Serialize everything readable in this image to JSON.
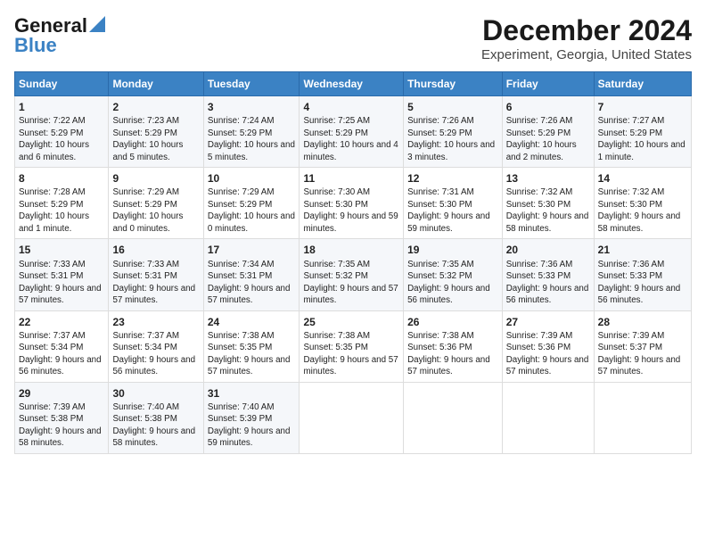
{
  "header": {
    "logo_line1": "General",
    "logo_line2": "Blue",
    "title": "December 2024",
    "subtitle": "Experiment, Georgia, United States"
  },
  "days_of_week": [
    "Sunday",
    "Monday",
    "Tuesday",
    "Wednesday",
    "Thursday",
    "Friday",
    "Saturday"
  ],
  "weeks": [
    [
      {
        "day": 1,
        "sunrise": "7:22 AM",
        "sunset": "5:29 PM",
        "daylight": "10 hours and 6 minutes."
      },
      {
        "day": 2,
        "sunrise": "7:23 AM",
        "sunset": "5:29 PM",
        "daylight": "10 hours and 5 minutes."
      },
      {
        "day": 3,
        "sunrise": "7:24 AM",
        "sunset": "5:29 PM",
        "daylight": "10 hours and 5 minutes."
      },
      {
        "day": 4,
        "sunrise": "7:25 AM",
        "sunset": "5:29 PM",
        "daylight": "10 hours and 4 minutes."
      },
      {
        "day": 5,
        "sunrise": "7:26 AM",
        "sunset": "5:29 PM",
        "daylight": "10 hours and 3 minutes."
      },
      {
        "day": 6,
        "sunrise": "7:26 AM",
        "sunset": "5:29 PM",
        "daylight": "10 hours and 2 minutes."
      },
      {
        "day": 7,
        "sunrise": "7:27 AM",
        "sunset": "5:29 PM",
        "daylight": "10 hours and 1 minute."
      }
    ],
    [
      {
        "day": 8,
        "sunrise": "7:28 AM",
        "sunset": "5:29 PM",
        "daylight": "10 hours and 1 minute."
      },
      {
        "day": 9,
        "sunrise": "7:29 AM",
        "sunset": "5:29 PM",
        "daylight": "10 hours and 0 minutes."
      },
      {
        "day": 10,
        "sunrise": "7:29 AM",
        "sunset": "5:29 PM",
        "daylight": "10 hours and 0 minutes."
      },
      {
        "day": 11,
        "sunrise": "7:30 AM",
        "sunset": "5:30 PM",
        "daylight": "9 hours and 59 minutes."
      },
      {
        "day": 12,
        "sunrise": "7:31 AM",
        "sunset": "5:30 PM",
        "daylight": "9 hours and 59 minutes."
      },
      {
        "day": 13,
        "sunrise": "7:32 AM",
        "sunset": "5:30 PM",
        "daylight": "9 hours and 58 minutes."
      },
      {
        "day": 14,
        "sunrise": "7:32 AM",
        "sunset": "5:30 PM",
        "daylight": "9 hours and 58 minutes."
      }
    ],
    [
      {
        "day": 15,
        "sunrise": "7:33 AM",
        "sunset": "5:31 PM",
        "daylight": "9 hours and 57 minutes."
      },
      {
        "day": 16,
        "sunrise": "7:33 AM",
        "sunset": "5:31 PM",
        "daylight": "9 hours and 57 minutes."
      },
      {
        "day": 17,
        "sunrise": "7:34 AM",
        "sunset": "5:31 PM",
        "daylight": "9 hours and 57 minutes."
      },
      {
        "day": 18,
        "sunrise": "7:35 AM",
        "sunset": "5:32 PM",
        "daylight": "9 hours and 57 minutes."
      },
      {
        "day": 19,
        "sunrise": "7:35 AM",
        "sunset": "5:32 PM",
        "daylight": "9 hours and 56 minutes."
      },
      {
        "day": 20,
        "sunrise": "7:36 AM",
        "sunset": "5:33 PM",
        "daylight": "9 hours and 56 minutes."
      },
      {
        "day": 21,
        "sunrise": "7:36 AM",
        "sunset": "5:33 PM",
        "daylight": "9 hours and 56 minutes."
      }
    ],
    [
      {
        "day": 22,
        "sunrise": "7:37 AM",
        "sunset": "5:34 PM",
        "daylight": "9 hours and 56 minutes."
      },
      {
        "day": 23,
        "sunrise": "7:37 AM",
        "sunset": "5:34 PM",
        "daylight": "9 hours and 56 minutes."
      },
      {
        "day": 24,
        "sunrise": "7:38 AM",
        "sunset": "5:35 PM",
        "daylight": "9 hours and 57 minutes."
      },
      {
        "day": 25,
        "sunrise": "7:38 AM",
        "sunset": "5:35 PM",
        "daylight": "9 hours and 57 minutes."
      },
      {
        "day": 26,
        "sunrise": "7:38 AM",
        "sunset": "5:36 PM",
        "daylight": "9 hours and 57 minutes."
      },
      {
        "day": 27,
        "sunrise": "7:39 AM",
        "sunset": "5:36 PM",
        "daylight": "9 hours and 57 minutes."
      },
      {
        "day": 28,
        "sunrise": "7:39 AM",
        "sunset": "5:37 PM",
        "daylight": "9 hours and 57 minutes."
      }
    ],
    [
      {
        "day": 29,
        "sunrise": "7:39 AM",
        "sunset": "5:38 PM",
        "daylight": "9 hours and 58 minutes."
      },
      {
        "day": 30,
        "sunrise": "7:40 AM",
        "sunset": "5:38 PM",
        "daylight": "9 hours and 58 minutes."
      },
      {
        "day": 31,
        "sunrise": "7:40 AM",
        "sunset": "5:39 PM",
        "daylight": "9 hours and 59 minutes."
      },
      null,
      null,
      null,
      null
    ]
  ]
}
